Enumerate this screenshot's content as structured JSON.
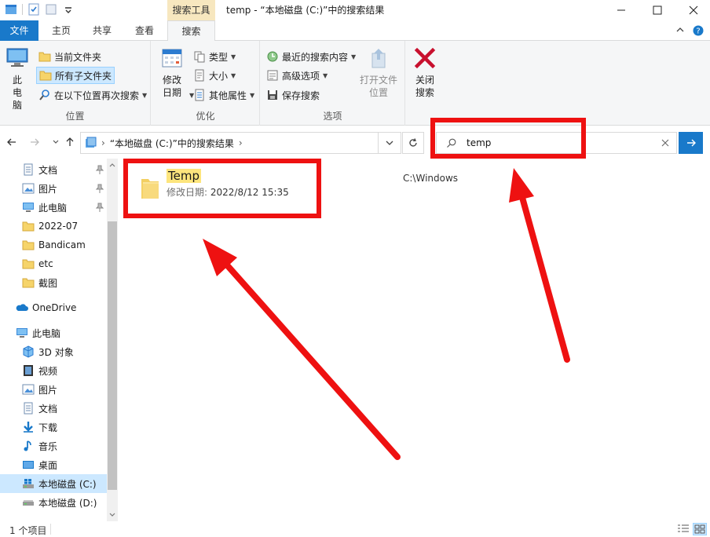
{
  "window": {
    "title": "temp - “本地磁盘 (C:)”中的搜索结果",
    "context_tab": "搜索工具"
  },
  "tabs": [
    {
      "label": "文件"
    },
    {
      "label": "主页"
    },
    {
      "label": "共享"
    },
    {
      "label": "查看"
    },
    {
      "label": "搜索"
    }
  ],
  "ribbon": {
    "location": {
      "label": "位置",
      "this_pc": "此电脑",
      "current_folder": "当前文件夹",
      "all_subfolders": "所有子文件夹",
      "search_again_in": "在以下位置再次搜索"
    },
    "refine": {
      "label": "优化",
      "date_modified": "修改日期",
      "type": "类型",
      "size": "大小",
      "other_properties": "其他属性"
    },
    "options": {
      "label": "选项",
      "recent_searches": "最近的搜索内容",
      "advanced_options": "高级选项",
      "save_search": "保存搜索",
      "open_file_location": "打开文件位置"
    },
    "close": {
      "close_search": "关闭搜索"
    }
  },
  "address": {
    "path": "“本地磁盘 (C:)”中的搜索结果"
  },
  "search": {
    "value": "temp"
  },
  "nav": {
    "quick_access": [
      {
        "label": "文档",
        "pinned": true
      },
      {
        "label": "图片",
        "pinned": true
      },
      {
        "label": "此电脑",
        "pinned": true
      },
      {
        "label": "2022-07"
      },
      {
        "label": "Bandicam"
      },
      {
        "label": "etc"
      },
      {
        "label": "截图"
      }
    ],
    "onedrive": "OneDrive",
    "this_pc": "此电脑",
    "pc_items": [
      {
        "label": "3D 对象"
      },
      {
        "label": "视频"
      },
      {
        "label": "图片"
      },
      {
        "label": "文档"
      },
      {
        "label": "下载"
      },
      {
        "label": "音乐"
      },
      {
        "label": "桌面"
      },
      {
        "label": "本地磁盘 (C:)"
      },
      {
        "label": "本地磁盘 (D:)"
      }
    ]
  },
  "results": [
    {
      "name": "Temp",
      "date_label": "修改日期:",
      "date": "2022/8/12 15:35",
      "location": "C:\\Windows"
    }
  ],
  "status": {
    "count": "1 个项目"
  },
  "colors": {
    "accent": "#1979ca",
    "highlight": "#ee1111",
    "selection": "#cce8ff",
    "search_hit": "#fde57d"
  }
}
